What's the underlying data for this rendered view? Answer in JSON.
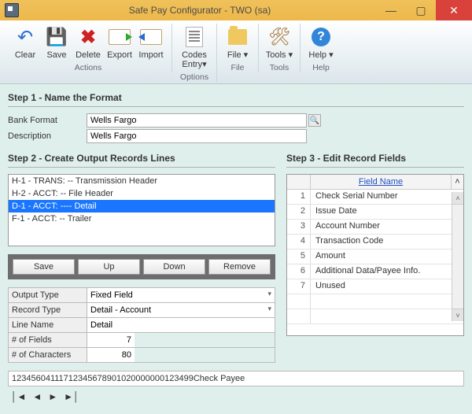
{
  "window": {
    "title": "Safe Pay Configurator  -  TWO (sa)"
  },
  "ribbon": {
    "buttons": {
      "clear": "Clear",
      "save": "Save",
      "delete": "Delete",
      "export": "Export",
      "import": "Import",
      "codes": "Codes Entry▾",
      "file": "File ▾",
      "tools": "Tools ▾",
      "help": "Help ▾"
    },
    "groups": {
      "actions": "Actions",
      "options": "Options",
      "file": "File",
      "tools": "Tools",
      "help": "Help"
    }
  },
  "step1": {
    "title": "Step 1 - Name the Format",
    "bankFormat": {
      "label": "Bank Format",
      "value": "Wells Fargo"
    },
    "description": {
      "label": "Description",
      "value": "Wells Fargo"
    }
  },
  "step2": {
    "title": "Step 2 - Create Output Records Lines",
    "lines": [
      "H-1 - TRANS:   -- Transmission Header",
      "H-2 - ACCT:   -- File Header",
      "D-1 - ACCT:   ---- Detail",
      "F-1 - ACCT:   -- Trailer"
    ],
    "selectedIndex": 2,
    "buttons": {
      "save": "Save",
      "up": "Up",
      "down": "Down",
      "remove": "Remove"
    },
    "props": {
      "outputType": {
        "label": "Output Type",
        "value": "Fixed Field"
      },
      "recordType": {
        "label": "Record Type",
        "value": "Detail - Account"
      },
      "lineName": {
        "label": "Line Name",
        "value": "Detail"
      },
      "numFields": {
        "label": "# of Fields",
        "value": "7"
      },
      "numChars": {
        "label": "# of Characters",
        "value": "80"
      }
    }
  },
  "step3": {
    "title": "Step 3 - Edit Record Fields",
    "columnHeader": "Field Name",
    "rows": [
      {
        "n": "1",
        "name": "Check Serial Number"
      },
      {
        "n": "2",
        "name": "Issue Date"
      },
      {
        "n": "3",
        "name": "Account Number"
      },
      {
        "n": "4",
        "name": "Transaction Code"
      },
      {
        "n": "5",
        "name": "Amount"
      },
      {
        "n": "6",
        "name": "Additional Data/Payee Info."
      },
      {
        "n": "7",
        "name": "Unused"
      }
    ]
  },
  "outputSample": "12345604111712345678901020000000123499Check Payee"
}
